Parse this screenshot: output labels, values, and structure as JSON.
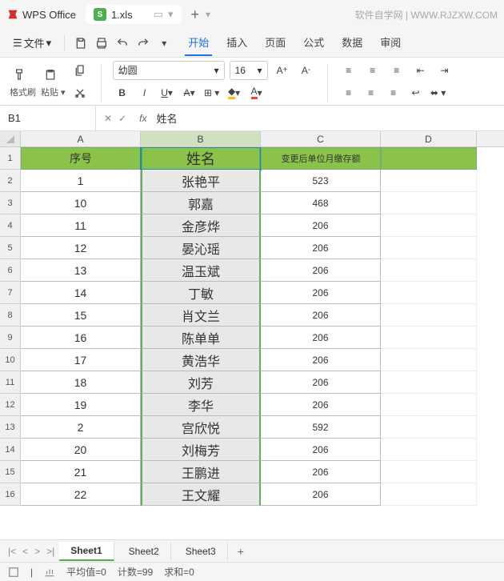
{
  "app": {
    "name": "WPS Office",
    "file": "1.xls",
    "watermark": "软件自学网 | WWW.RJZXW.COM"
  },
  "menu": {
    "file": "文件",
    "tabs": {
      "start": "开始",
      "insert": "插入",
      "page": "页面",
      "formula": "公式",
      "data": "数据",
      "review": "审阅"
    }
  },
  "toolbar": {
    "format_brush": "格式刷",
    "paste": "粘贴",
    "font_name": "幼圆",
    "font_size": "16"
  },
  "formula_bar": {
    "cell_ref": "B1",
    "value": "姓名"
  },
  "columns": {
    "A": "A",
    "B": "B",
    "C": "C",
    "D": "D"
  },
  "header_row": {
    "A": "序号",
    "B": "姓名",
    "C": "变更后单位月缴存额"
  },
  "chart_data": {
    "type": "table",
    "columns": [
      "序号",
      "姓名",
      "变更后单位月缴存额"
    ],
    "rows": [
      {
        "n": "1",
        "A": "1",
        "B": "张艳平",
        "C": "523"
      },
      {
        "n": "2",
        "A": "10",
        "B": "郭嘉",
        "C": "468"
      },
      {
        "n": "3",
        "A": "11",
        "B": "金彦烨",
        "C": "206"
      },
      {
        "n": "4",
        "A": "12",
        "B": "晏沁瑶",
        "C": "206"
      },
      {
        "n": "5",
        "A": "13",
        "B": "温玉斌",
        "C": "206"
      },
      {
        "n": "6",
        "A": "14",
        "B": "丁敏",
        "C": "206"
      },
      {
        "n": "7",
        "A": "15",
        "B": "肖文兰",
        "C": "206"
      },
      {
        "n": "8",
        "A": "16",
        "B": "陈单单",
        "C": "206"
      },
      {
        "n": "9",
        "A": "17",
        "B": "黄浩华",
        "C": "206"
      },
      {
        "n": "10",
        "A": "18",
        "B": "刘芳",
        "C": "206"
      },
      {
        "n": "11",
        "A": "19",
        "B": "李华",
        "C": "206"
      },
      {
        "n": "12",
        "A": "2",
        "B": "宫欣悦",
        "C": "592"
      },
      {
        "n": "13",
        "A": "20",
        "B": "刘梅芳",
        "C": "206"
      },
      {
        "n": "14",
        "A": "21",
        "B": "王鹏进",
        "C": "206"
      },
      {
        "n": "15",
        "A": "22",
        "B": "王文耀",
        "C": "206"
      }
    ]
  },
  "sheets": {
    "s1": "Sheet1",
    "s2": "Sheet2",
    "s3": "Sheet3"
  },
  "status": {
    "avg": "平均值=0",
    "count": "计数=99",
    "sum": "求和=0"
  }
}
